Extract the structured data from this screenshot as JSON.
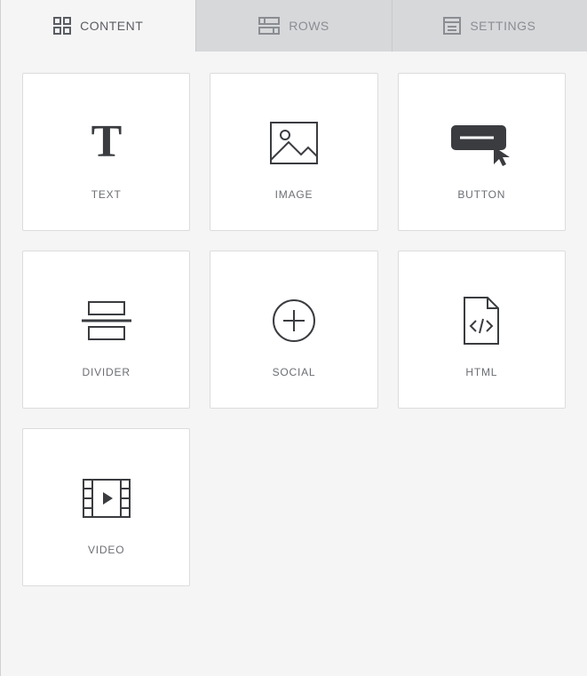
{
  "tabs": {
    "content": {
      "label": "CONTENT",
      "active": true
    },
    "rows": {
      "label": "ROWS",
      "active": false
    },
    "settings": {
      "label": "SETTINGS",
      "active": false
    }
  },
  "tiles": {
    "text": {
      "label": "TEXT"
    },
    "image": {
      "label": "IMAGE"
    },
    "button": {
      "label": "BUTTON"
    },
    "divider": {
      "label": "DIVIDER"
    },
    "social": {
      "label": "SOCIAL"
    },
    "html": {
      "label": "HTML"
    },
    "video": {
      "label": "VIDEO"
    }
  }
}
